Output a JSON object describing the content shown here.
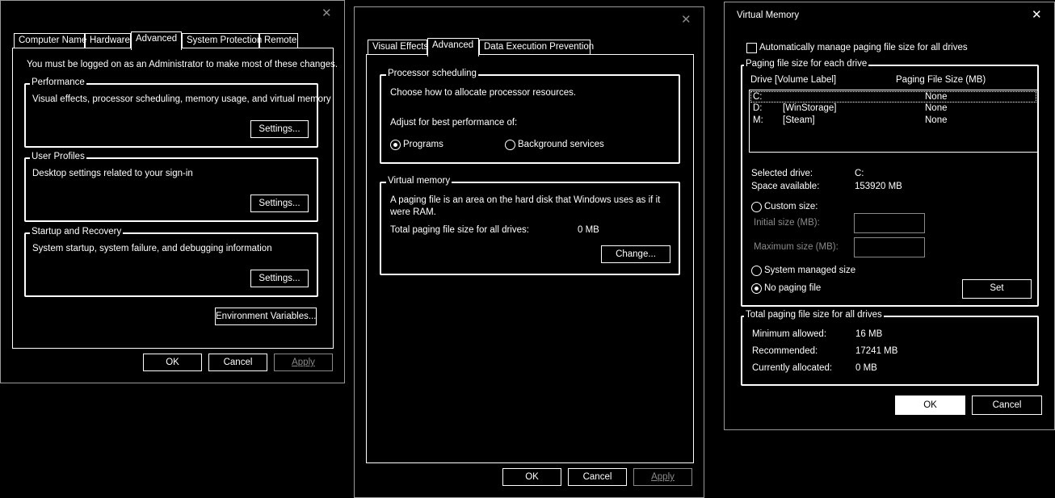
{
  "sys_props": {
    "close_glyph": "✕",
    "tabs": [
      "Computer Name",
      "Hardware",
      "Advanced",
      "System Protection",
      "Remote"
    ],
    "admin_note": "You must be logged on as an Administrator to make most of these changes.",
    "performance": {
      "title": "Performance",
      "desc": "Visual effects, processor scheduling, memory usage, and virtual memory",
      "button": "Settings..."
    },
    "user_profiles": {
      "title": "User Profiles",
      "desc": "Desktop settings related to your sign-in",
      "button": "Settings..."
    },
    "startup": {
      "title": "Startup and Recovery",
      "desc": "System startup, system failure, and debugging information",
      "button": "Settings..."
    },
    "env_button": "Environment Variables...",
    "ok": "OK",
    "cancel": "Cancel",
    "apply": "Apply"
  },
  "perf_options": {
    "close_glyph": "✕",
    "tabs": [
      "Visual Effects",
      "Advanced",
      "Data Execution Prevention"
    ],
    "processor": {
      "title": "Processor scheduling",
      "desc": "Choose how to allocate processor resources.",
      "adjust": "Adjust for best performance of:",
      "opt_programs": "Programs",
      "opt_background": "Background services",
      "selected": "Programs"
    },
    "virtual_memory": {
      "title": "Virtual memory",
      "desc_line1": "A paging file is an area on the hard disk that Windows uses as if it",
      "desc_line2": "were RAM.",
      "total_label": "Total paging file size for all drives:",
      "total_value": "0 MB",
      "change_button": "Change..."
    },
    "ok": "OK",
    "cancel": "Cancel",
    "apply": "Apply"
  },
  "virtual_memory_dialog": {
    "title": "Virtual Memory",
    "close_glyph": "✕",
    "auto_manage_label": "Automatically manage paging file size for all drives",
    "auto_manage_checked": false,
    "per_drive_title": "Paging file size for each drive",
    "col_drive": "Drive  [Volume Label]",
    "col_size": "Paging File Size (MB)",
    "drives": [
      {
        "drive": "C:",
        "label": "",
        "size": "None"
      },
      {
        "drive": "D:",
        "label": "[WinStorage]",
        "size": "None"
      },
      {
        "drive": "M:",
        "label": "[Steam]",
        "size": "None"
      }
    ],
    "selected_drive_label": "Selected drive:",
    "selected_drive_value": "C:",
    "space_available_label": "Space available:",
    "space_available_value": "153920 MB",
    "custom_size": "Custom size:",
    "initial_size": "Initial size (MB):",
    "maximum_size": "Maximum size (MB):",
    "system_managed": "System managed size",
    "no_paging": "No paging file",
    "selected_option": "No paging file",
    "set_button": "Set",
    "totals_title": "Total paging file size for all drives",
    "min_allowed_label": "Minimum allowed:",
    "min_allowed_value": "16 MB",
    "recommended_label": "Recommended:",
    "recommended_value": "17241 MB",
    "allocated_label": "Currently allocated:",
    "allocated_value": "0 MB",
    "ok": "OK",
    "cancel": "Cancel"
  }
}
